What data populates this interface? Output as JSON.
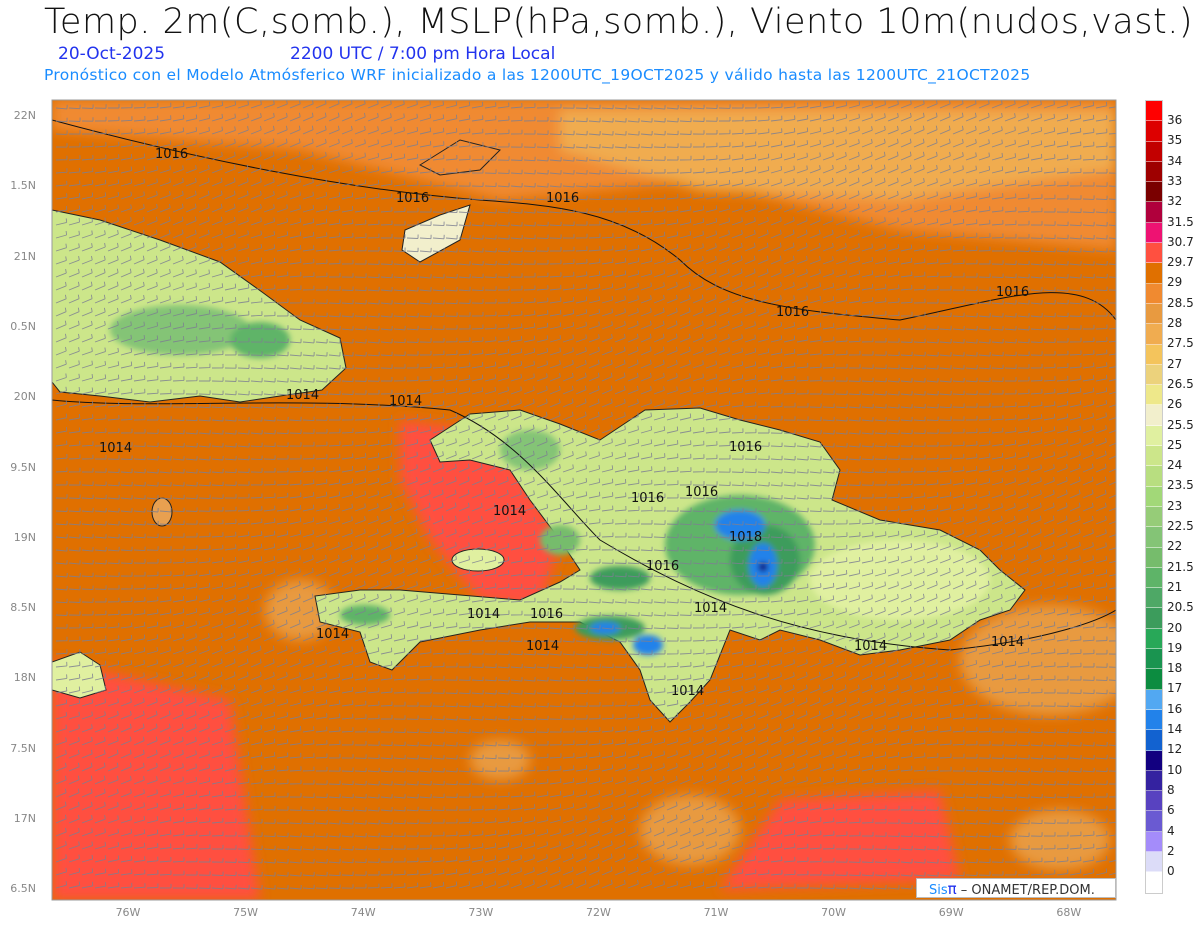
{
  "header": {
    "title": "Temp. 2m(C,somb.), MSLP(hPa,somb.), Viento 10m(nudos,vast.)",
    "date": "20-Oct-2025",
    "time": "2200 UTC / 7:00 pm Hora Local",
    "forecast_note": "Pronóstico con el Modelo Atmósferico WRF inicializado a las 1200UTC_19OCT2025 y válido hasta las  1200UTC_21OCT2025"
  },
  "axes": {
    "lat_labels": [
      "22N",
      "1.5N",
      "21N",
      "0.5N",
      "20N",
      "9.5N",
      "19N",
      "8.5N",
      "18N",
      "7.5N",
      "17N",
      "6.5N"
    ],
    "lon_labels": [
      "76W",
      "75W",
      "74W",
      "73W",
      "72W",
      "71W",
      "70W",
      "69W",
      "68W"
    ]
  },
  "isobars": {
    "labels_1016": [
      "1016",
      "1016",
      "1016",
      "1016",
      "1016",
      "1016",
      "1016",
      "1016",
      "1016",
      "1016"
    ],
    "labels_1018": [
      "1018"
    ],
    "labels_1014": [
      "1014",
      "1014",
      "1014",
      "1014",
      "1014",
      "1014",
      "1014",
      "1014",
      "1014",
      "1014",
      "1014"
    ]
  },
  "colorbar": {
    "labels": [
      "36",
      "35",
      "34",
      "33",
      "32",
      "31.5",
      "30.7",
      "29.7",
      "29",
      "28.5",
      "28",
      "27.5",
      "27",
      "26.5",
      "26",
      "25.5",
      "25",
      "24",
      "23.5",
      "23",
      "22.5",
      "22",
      "21.5",
      "21",
      "20.5",
      "20",
      "19",
      "18",
      "17",
      "16",
      "14",
      "12",
      "10",
      "8",
      "6",
      "4",
      "2",
      "0"
    ],
    "colors": [
      "#ff0000",
      "#dd0000",
      "#c20000",
      "#9e0000",
      "#7a0000",
      "#b0003c",
      "#ee1272",
      "#ff5040",
      "#e07000",
      "#f08a30",
      "#e89a40",
      "#f0ac50",
      "#f4c45c",
      "#ecd27c",
      "#eee88a",
      "#f2efcc",
      "#e0f0a0",
      "#cce68a",
      "#b8de80",
      "#a2d878",
      "#96cc78",
      "#84c476",
      "#76bc6c",
      "#5eb468",
      "#4ea866",
      "#3c9c5c",
      "#28a858",
      "#1a9450",
      "#0c8c40",
      "#52a8f2",
      "#2282ea",
      "#1262d0",
      "#120080",
      "#3422a0",
      "#5842c0",
      "#6a5ad2",
      "#a48cfa",
      "#dcdcf8",
      "#ffffff"
    ]
  },
  "credit": {
    "sis": "Sis",
    "pi": "π",
    "org": " – ONAMET/REP.DOM."
  }
}
